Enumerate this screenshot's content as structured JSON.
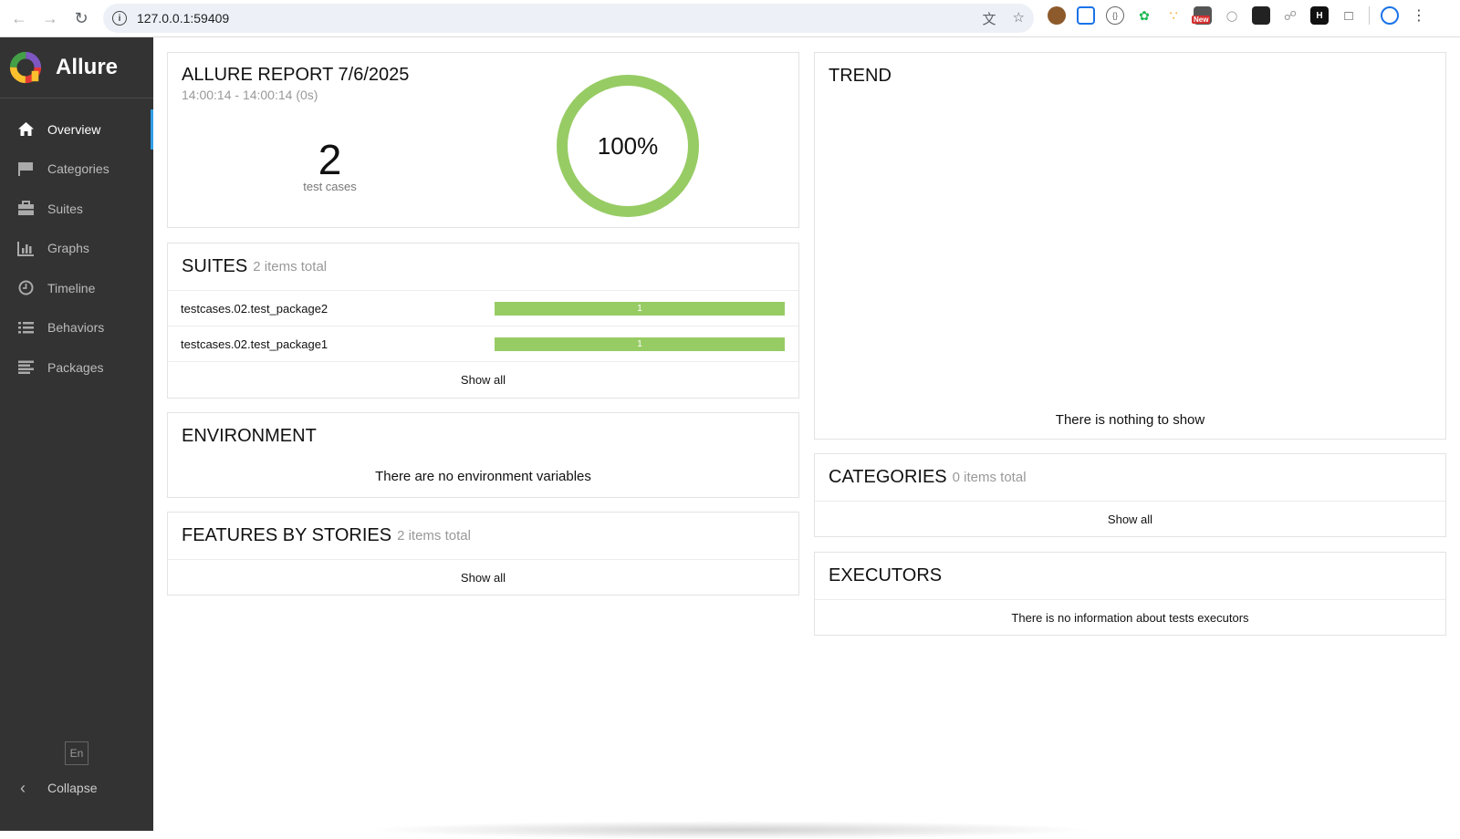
{
  "browser": {
    "url": "127.0.0.1:59409",
    "new_badge": "New"
  },
  "sidebar": {
    "brand": "Allure",
    "items": [
      {
        "label": "Overview",
        "icon": "home-icon"
      },
      {
        "label": "Categories",
        "icon": "flag-icon"
      },
      {
        "label": "Suites",
        "icon": "briefcase-icon"
      },
      {
        "label": "Graphs",
        "icon": "bar-chart-icon"
      },
      {
        "label": "Timeline",
        "icon": "clock-icon"
      },
      {
        "label": "Behaviors",
        "icon": "list-icon"
      },
      {
        "label": "Packages",
        "icon": "align-left-icon"
      }
    ],
    "language": "En",
    "collapse": "Collapse"
  },
  "summary": {
    "title": "ALLURE REPORT 7/6/2025",
    "time": "14:00:14 - 14:00:14 (0s)",
    "count": "2",
    "count_label": "test cases",
    "percent": "100%",
    "pass_fraction": 1.0
  },
  "suites": {
    "title": "SUITES",
    "count": "2 items total",
    "rows": [
      {
        "name": "testcases.02.test_package2",
        "passed": "1"
      },
      {
        "name": "testcases.02.test_package1",
        "passed": "1"
      }
    ],
    "show_all": "Show all"
  },
  "environment": {
    "title": "ENVIRONMENT",
    "message": "There are no environment variables"
  },
  "features": {
    "title": "FEATURES BY STORIES",
    "count": "2 items total",
    "show_all": "Show all"
  },
  "trend": {
    "title": "TREND",
    "message": "There is nothing to show"
  },
  "categories": {
    "title": "CATEGORIES",
    "count": "0 items total",
    "show_all": "Show all"
  },
  "executors": {
    "title": "EXECUTORS",
    "message": "There is no information about tests executors"
  },
  "colors": {
    "passed": "#97cc64",
    "sidebar": "#333333",
    "active_accent": "#2f9ee8"
  }
}
